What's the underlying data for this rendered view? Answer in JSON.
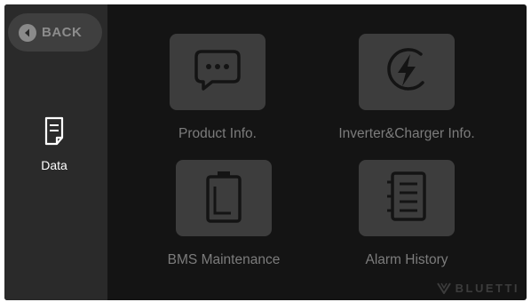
{
  "sidebar": {
    "back_label": "BACK",
    "nav_item_label": "Data"
  },
  "tiles": [
    {
      "label": "Product Info.",
      "icon": "chat-bubble-icon"
    },
    {
      "label": "Inverter&Charger Info.",
      "icon": "lightning-bolt-icon"
    },
    {
      "label": "BMS Maintenance",
      "icon": "battery-icon"
    },
    {
      "label": "Alarm History",
      "icon": "list-document-icon"
    }
  ],
  "brand": {
    "logo_text": "BLUETTI"
  },
  "colors": {
    "screen_bg": "#141414",
    "sidebar_bg": "#2a2a2a",
    "tile_bg": "#3d3d3d",
    "icon_stroke": "#141414",
    "label_text": "#7c7c7c",
    "active_text": "#ffffff"
  }
}
